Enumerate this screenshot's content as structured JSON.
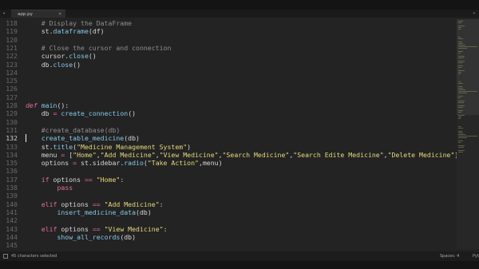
{
  "tabs": [
    {
      "label": "app.py",
      "close": "×"
    }
  ],
  "tab_nav": {
    "left": "◂",
    "right": "▸"
  },
  "editor": {
    "lines": [
      {
        "n": "118",
        "tokens": [
          {
            "t": "    # Display the DataFrame",
            "c": "comment"
          }
        ]
      },
      {
        "n": "119",
        "tokens": [
          {
            "t": "    st.",
            "c": "plain"
          },
          {
            "t": "dataframe",
            "c": "fn"
          },
          {
            "t": "(df)",
            "c": "plain"
          }
        ]
      },
      {
        "n": "120",
        "tokens": []
      },
      {
        "n": "121",
        "tokens": [
          {
            "t": "    # Close the cursor and connection",
            "c": "comment"
          }
        ]
      },
      {
        "n": "122",
        "tokens": [
          {
            "t": "    cursor.",
            "c": "plain"
          },
          {
            "t": "close",
            "c": "fn"
          },
          {
            "t": "()",
            "c": "plain"
          }
        ]
      },
      {
        "n": "123",
        "tokens": [
          {
            "t": "    db.",
            "c": "plain"
          },
          {
            "t": "close",
            "c": "fn"
          },
          {
            "t": "()",
            "c": "plain"
          }
        ]
      },
      {
        "n": "124",
        "tokens": []
      },
      {
        "n": "125",
        "tokens": []
      },
      {
        "n": "126",
        "tokens": []
      },
      {
        "n": "127",
        "tokens": []
      },
      {
        "n": "128",
        "tokens": [
          {
            "t": "def",
            "c": "kw"
          },
          {
            "t": " ",
            "c": "plain"
          },
          {
            "t": "main",
            "c": "fn"
          },
          {
            "t": "():",
            "c": "plain"
          }
        ]
      },
      {
        "n": "129",
        "tokens": [
          {
            "t": "    db ",
            "c": "plain"
          },
          {
            "t": "=",
            "c": "op"
          },
          {
            "t": " ",
            "c": "plain"
          },
          {
            "t": "create_connection",
            "c": "fn"
          },
          {
            "t": "()",
            "c": "plain"
          }
        ]
      },
      {
        "n": "130",
        "tokens": []
      },
      {
        "n": "131",
        "tokens": [
          {
            "t": "    #create_database(db)",
            "c": "comment"
          }
        ]
      },
      {
        "n": "132",
        "tokens": [
          {
            "t": "    ",
            "c": "plain"
          },
          {
            "t": "create_table_medicine",
            "c": "fn"
          },
          {
            "t": "(db)",
            "c": "plain"
          }
        ]
      },
      {
        "n": "133",
        "tokens": [
          {
            "t": "    st.",
            "c": "plain"
          },
          {
            "t": "title",
            "c": "fn"
          },
          {
            "t": "(",
            "c": "plain"
          },
          {
            "t": "\"Medicine Management System\"",
            "c": "str"
          },
          {
            "t": ")",
            "c": "plain"
          }
        ]
      },
      {
        "n": "134",
        "tokens": [
          {
            "t": "    menu ",
            "c": "plain"
          },
          {
            "t": "=",
            "c": "op"
          },
          {
            "t": " [",
            "c": "plain"
          },
          {
            "t": "\"Home\"",
            "c": "str"
          },
          {
            "t": ",",
            "c": "plain"
          },
          {
            "t": "\"Add Medicine\"",
            "c": "str"
          },
          {
            "t": ",",
            "c": "plain"
          },
          {
            "t": "\"View Medicine\"",
            "c": "str"
          },
          {
            "t": ",",
            "c": "plain"
          },
          {
            "t": "\"Search Medicine\"",
            "c": "str"
          },
          {
            "t": ",",
            "c": "plain"
          },
          {
            "t": "\"Search Edite Medicine\"",
            "c": "str"
          },
          {
            "t": ",",
            "c": "plain"
          },
          {
            "t": "\"Delete Medicine\"",
            "c": "str"
          },
          {
            "t": "]",
            "c": "plain"
          }
        ]
      },
      {
        "n": "135",
        "tokens": [
          {
            "t": "    options ",
            "c": "plain"
          },
          {
            "t": "=",
            "c": "op"
          },
          {
            "t": " st.sidebar.",
            "c": "plain"
          },
          {
            "t": "radio",
            "c": "fn"
          },
          {
            "t": "(",
            "c": "plain"
          },
          {
            "t": "\"Take Action\"",
            "c": "str"
          },
          {
            "t": ",menu)",
            "c": "plain"
          }
        ]
      },
      {
        "n": "136",
        "tokens": []
      },
      {
        "n": "137",
        "tokens": [
          {
            "t": "    ",
            "c": "plain"
          },
          {
            "t": "if",
            "c": "op"
          },
          {
            "t": " options ",
            "c": "plain"
          },
          {
            "t": "==",
            "c": "op"
          },
          {
            "t": " ",
            "c": "plain"
          },
          {
            "t": "\"Home\"",
            "c": "str"
          },
          {
            "t": ":",
            "c": "plain"
          }
        ]
      },
      {
        "n": "138",
        "tokens": [
          {
            "t": "        ",
            "c": "plain"
          },
          {
            "t": "pass",
            "c": "op"
          }
        ]
      },
      {
        "n": "139",
        "tokens": []
      },
      {
        "n": "140",
        "tokens": [
          {
            "t": "    ",
            "c": "plain"
          },
          {
            "t": "elif",
            "c": "op"
          },
          {
            "t": " options ",
            "c": "plain"
          },
          {
            "t": "==",
            "c": "op"
          },
          {
            "t": " ",
            "c": "plain"
          },
          {
            "t": "\"Add Medicine\"",
            "c": "str"
          },
          {
            "t": ":",
            "c": "plain"
          }
        ]
      },
      {
        "n": "141",
        "tokens": [
          {
            "t": "        ",
            "c": "plain"
          },
          {
            "t": "insert_medicine_data",
            "c": "fn"
          },
          {
            "t": "(db)",
            "c": "plain"
          }
        ]
      },
      {
        "n": "142",
        "tokens": []
      },
      {
        "n": "143",
        "tokens": [
          {
            "t": "    ",
            "c": "plain"
          },
          {
            "t": "elif",
            "c": "op"
          },
          {
            "t": " options ",
            "c": "plain"
          },
          {
            "t": "==",
            "c": "op"
          },
          {
            "t": " ",
            "c": "plain"
          },
          {
            "t": "\"View Medicine\"",
            "c": "str"
          },
          {
            "t": ":",
            "c": "plain"
          }
        ]
      },
      {
        "n": "144",
        "tokens": [
          {
            "t": "        ",
            "c": "plain"
          },
          {
            "t": "show_all_records",
            "c": "fn"
          },
          {
            "t": "(db)",
            "c": "plain"
          }
        ]
      },
      {
        "n": "145",
        "tokens": []
      }
    ],
    "current_line": "132"
  },
  "status": {
    "selection": "45 characters selected",
    "spaces": "Spaces: 4",
    "syntax": "Pyt"
  },
  "colors": {
    "background": "#232323",
    "comment": "#8e8e8e",
    "keyword": "#e06c9f",
    "function": "#84c8e8",
    "string": "#e6d97a"
  }
}
